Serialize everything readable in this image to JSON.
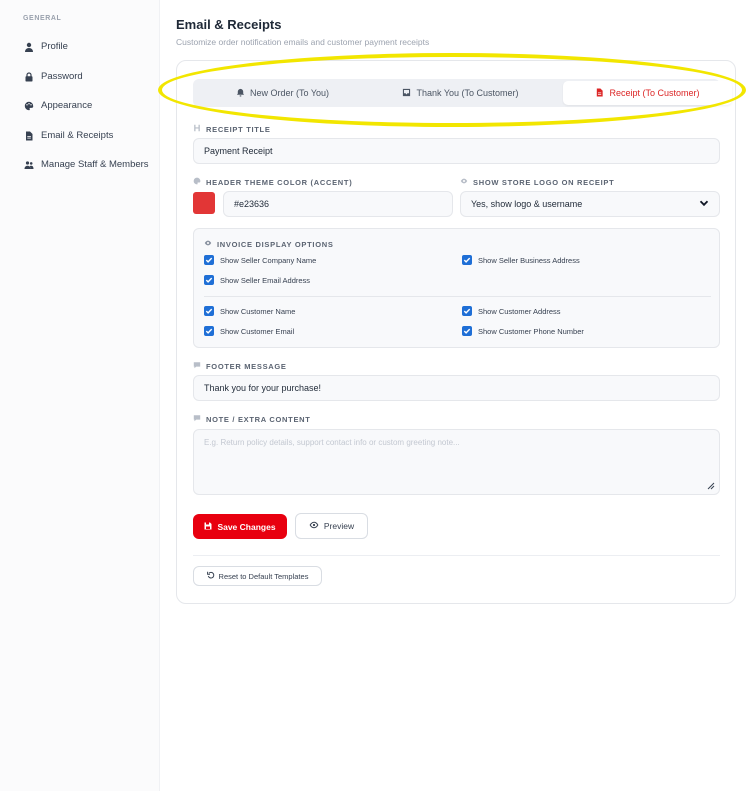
{
  "sidebar": {
    "section": "GENERAL",
    "items": [
      {
        "label": "Profile",
        "icon": "user-icon"
      },
      {
        "label": "Password",
        "icon": "lock-icon"
      },
      {
        "label": "Appearance",
        "icon": "palette-icon"
      },
      {
        "label": "Email & Receipts",
        "icon": "document-icon"
      },
      {
        "label": "Manage Staff & Members",
        "icon": "users-icon"
      }
    ]
  },
  "header": {
    "title": "Email & Receipts",
    "subtitle": "Customize order notification emails and customer payment receipts"
  },
  "tabs": [
    {
      "label": "New Order (To You)",
      "icon": "bell-icon",
      "active": false
    },
    {
      "label": "Thank You (To Customer)",
      "icon": "inbox-icon",
      "active": false
    },
    {
      "label": "Receipt (To Customer)",
      "icon": "receipt-icon",
      "active": true
    }
  ],
  "form": {
    "receipt_title_label": "RECEIPT TITLE",
    "receipt_title_value": "Payment Receipt",
    "theme_color_label": "HEADER THEME COLOR (ACCENT)",
    "theme_color_value": "#e23636",
    "logo_label": "SHOW STORE LOGO ON RECEIPT",
    "logo_value": "Yes, show logo & username",
    "options_label": "INVOICE DISPLAY OPTIONS",
    "options": [
      {
        "label": "Show Seller Company Name",
        "checked": true
      },
      {
        "label": "Show Seller Business Address",
        "checked": true
      },
      {
        "label": "Show Seller Email Address",
        "checked": true
      },
      {
        "label": "Show Customer Name",
        "checked": true
      },
      {
        "label": "Show Customer Address",
        "checked": true
      },
      {
        "label": "Show Customer Email",
        "checked": true
      },
      {
        "label": "Show Customer Phone Number",
        "checked": true
      }
    ],
    "footer_label": "FOOTER MESSAGE",
    "footer_value": "Thank you for your purchase!",
    "note_label": "NOTE / EXTRA CONTENT",
    "note_placeholder": "E.g. Return policy details, support contact info or custom greeting note..."
  },
  "actions": {
    "save": "Save Changes",
    "preview": "Preview",
    "reset": "Reset to Default Templates"
  },
  "colors": {
    "accent": "#e8000f",
    "checkbox": "#1f6fd6",
    "highlight": "#f2e600"
  }
}
